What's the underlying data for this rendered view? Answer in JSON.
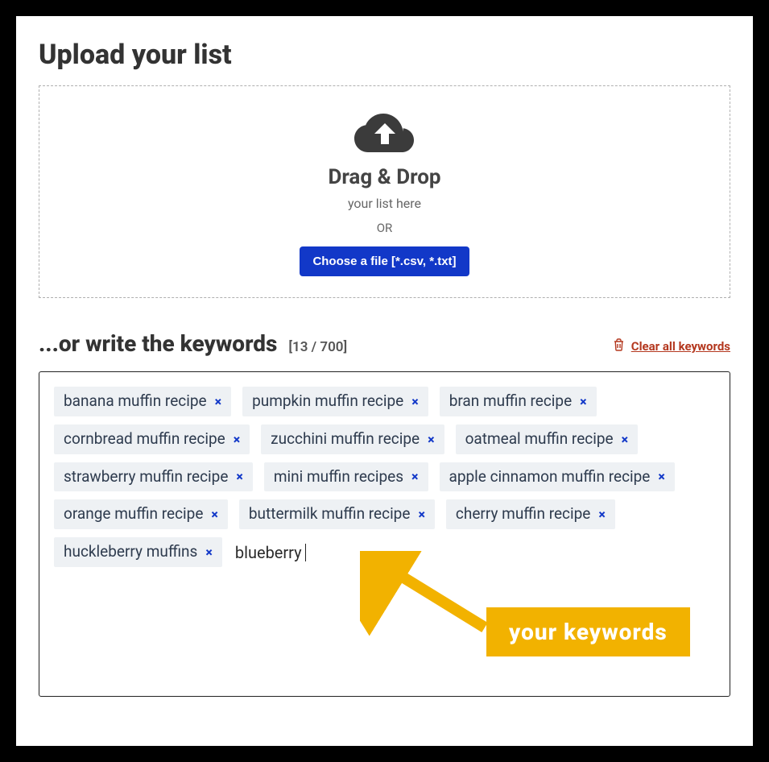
{
  "upload": {
    "title": "Upload your list",
    "drag_title": "Drag & Drop",
    "drag_sub": "your list here",
    "or": "OR",
    "choose_label": "Choose a file [*.csv, *.txt]"
  },
  "write": {
    "title": "...or write the keywords",
    "counter": "[13 / 700]",
    "clear_label": "Clear all keywords"
  },
  "keywords": [
    "banana muffin recipe",
    "pumpkin muffin recipe",
    "bran muffin recipe",
    "cornbread muffin recipe",
    "zucchini muffin recipe",
    "oatmeal muffin recipe",
    "strawberry muffin recipe",
    "mini muffin recipes",
    "apple cinnamon muffin recipe",
    "orange muffin recipe",
    "buttermilk muffin recipe",
    "cherry muffin recipe",
    "huckleberry muffins"
  ],
  "typing": "blueberry",
  "callout": "your keywords",
  "colors": {
    "primary": "#1238c8",
    "danger": "#b4381f",
    "accent": "#f2b200"
  }
}
